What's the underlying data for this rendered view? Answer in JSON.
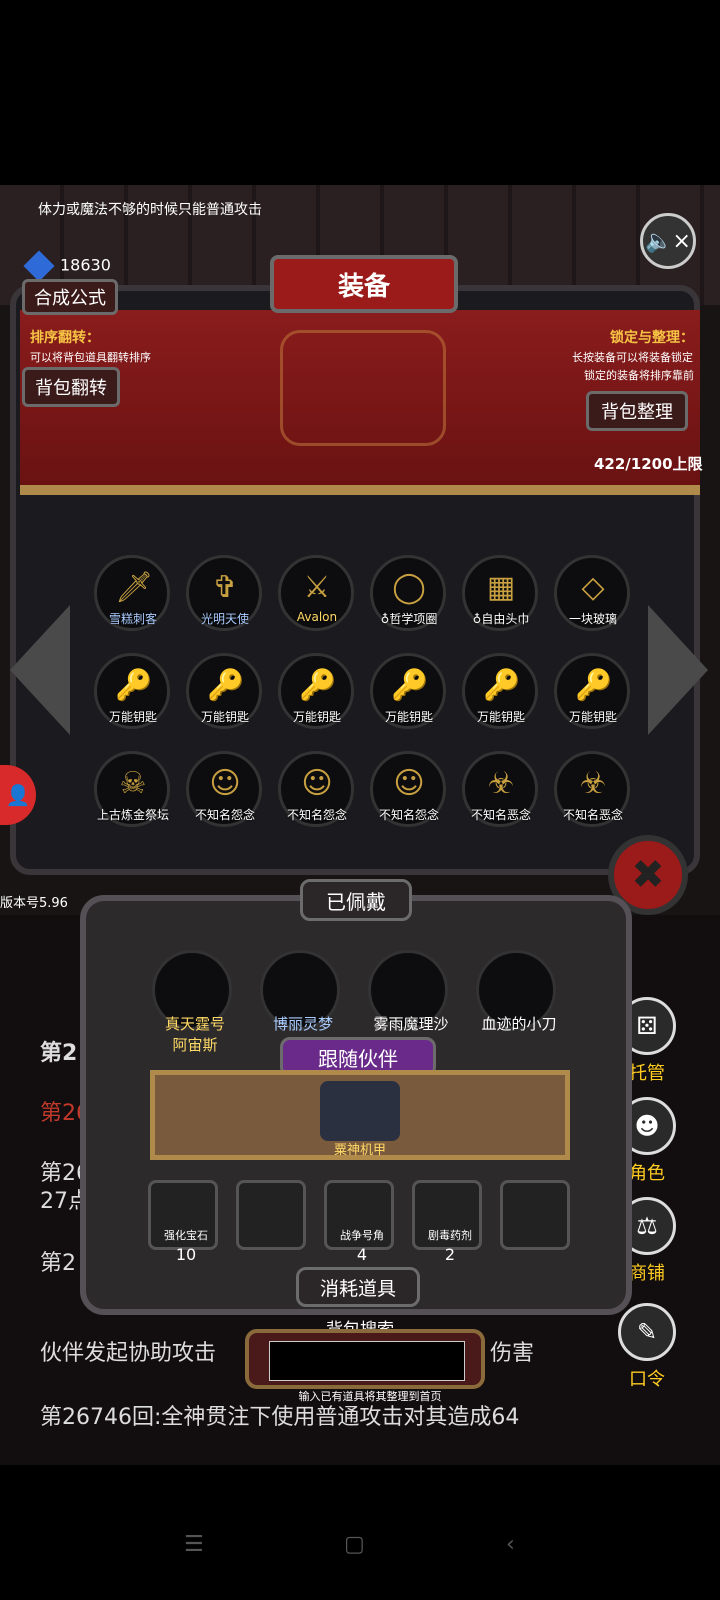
{
  "tip": "体力或魔法不够的时候只能普通攻击",
  "gem_count": "18630",
  "title": "装备",
  "buttons": {
    "compose": "合成公式",
    "reverse": "背包翻转",
    "sort": "背包整理"
  },
  "hints": {
    "sort_title": "排序翻转：",
    "sort_desc": "可以将背包道具翻转排序",
    "lock_title": "锁定与整理：",
    "lock_desc1": "长按装备可以将装备锁定",
    "lock_desc2": "锁定的装备将排序靠前"
  },
  "capacity": "422/1200上限",
  "inventory": [
    {
      "label": "雪糕刺客",
      "icon": "dagger-icon",
      "color": "#aaccff"
    },
    {
      "label": "光明天使",
      "icon": "angel-icon",
      "color": "#aaccff"
    },
    {
      "label": "Avalon",
      "icon": "sword-icon",
      "color": "#ffd966"
    },
    {
      "label": "♁哲学项圈",
      "icon": "collar-icon",
      "color": "#ffffff"
    },
    {
      "label": "♁自由头巾",
      "icon": "bandana-icon",
      "color": "#ffffff"
    },
    {
      "label": "一块玻璃",
      "icon": "glass-icon",
      "color": "#ffffff"
    },
    {
      "label": "万能钥匙",
      "icon": "key-icon",
      "color": "#ffffff"
    },
    {
      "label": "万能钥匙",
      "icon": "key-icon",
      "color": "#ffffff"
    },
    {
      "label": "万能钥匙",
      "icon": "key-icon",
      "color": "#ffffff"
    },
    {
      "label": "万能钥匙",
      "icon": "key-icon",
      "color": "#ffffff"
    },
    {
      "label": "万能钥匙",
      "icon": "key-icon",
      "color": "#ffffff"
    },
    {
      "label": "万能钥匙",
      "icon": "key-icon",
      "color": "#ffffff"
    },
    {
      "label": "上古炼金祭坛",
      "icon": "skull-altar-icon",
      "color": "#ffffff"
    },
    {
      "label": "不知名怨念",
      "icon": "ghost-icon",
      "color": "#ffffff"
    },
    {
      "label": "不知名怨念",
      "icon": "ghost-icon",
      "color": "#ffffff"
    },
    {
      "label": "不知名怨念",
      "icon": "ghost-icon",
      "color": "#ffffff"
    },
    {
      "label": "不知名恶念",
      "icon": "demon-icon",
      "color": "#ffffff"
    },
    {
      "label": "不知名恶念",
      "icon": "demon-icon",
      "color": "#ffffff"
    }
  ],
  "equipped_title": "已佩戴",
  "equipped": [
    {
      "line1": "真天霆号",
      "line2": "阿宙斯",
      "color": "#ffd966"
    },
    {
      "line1": "博丽灵梦",
      "line2": "",
      "color": "#aaccff"
    },
    {
      "line1": "雾雨魔理沙",
      "line2": "",
      "color": "#ffffff"
    },
    {
      "line1": "血迹的小刀",
      "line2": "",
      "color": "#ffffff"
    }
  ],
  "companion_title": "跟随伙伴",
  "companion": "粟神机甲",
  "consumables": [
    {
      "label": "强化宝石",
      "count": "10"
    },
    {
      "label": "",
      "count": ""
    },
    {
      "label": "战争号角",
      "count": "4"
    },
    {
      "label": "剧毒药剂",
      "count": "2"
    },
    {
      "label": "",
      "count": ""
    }
  ],
  "consumables_title": "消耗道具",
  "search": {
    "title": "背包搜索",
    "hint": "输入已有道具将其整理到首页",
    "value": ""
  },
  "version": "版本号5.96",
  "side_menu": [
    "托管",
    "角色",
    "商铺",
    "口令"
  ],
  "log": {
    "line1": "第2",
    "line2": "第26",
    "line3": "第26",
    "line3b": "27点",
    "line4": "第2",
    "line5": "伙伴发起协助攻击",
    "line5b": "伤害",
    "line6": "第26746回:全神贯注下使用普通攻击对其造成64"
  }
}
